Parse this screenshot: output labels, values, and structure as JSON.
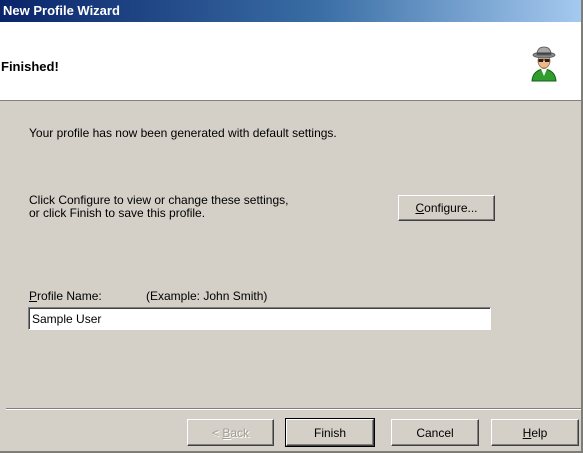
{
  "window": {
    "title": "New Profile Wizard"
  },
  "header": {
    "title": "Finished!",
    "icon": "user-wizard-icon"
  },
  "content": {
    "generated_text": "Your profile has now been generated with default settings.",
    "instruction_line1": "Click Configure to view or change these settings,",
    "instruction_line2": "or click Finish to save this profile.",
    "configure_label_accel": "C",
    "configure_label_rest": "onfigure...",
    "profile_name_label_accel": "P",
    "profile_name_label_rest": "rofile Name:",
    "profile_name_example": "(Example: John Smith)",
    "profile_name_value": "Sample User"
  },
  "footer": {
    "back_label_prefix": "< ",
    "back_label_accel": "B",
    "back_label_rest": "ack",
    "finish_label": "Finish",
    "cancel_label": "Cancel",
    "help_label_accel": "H",
    "help_label_rest": "elp"
  }
}
